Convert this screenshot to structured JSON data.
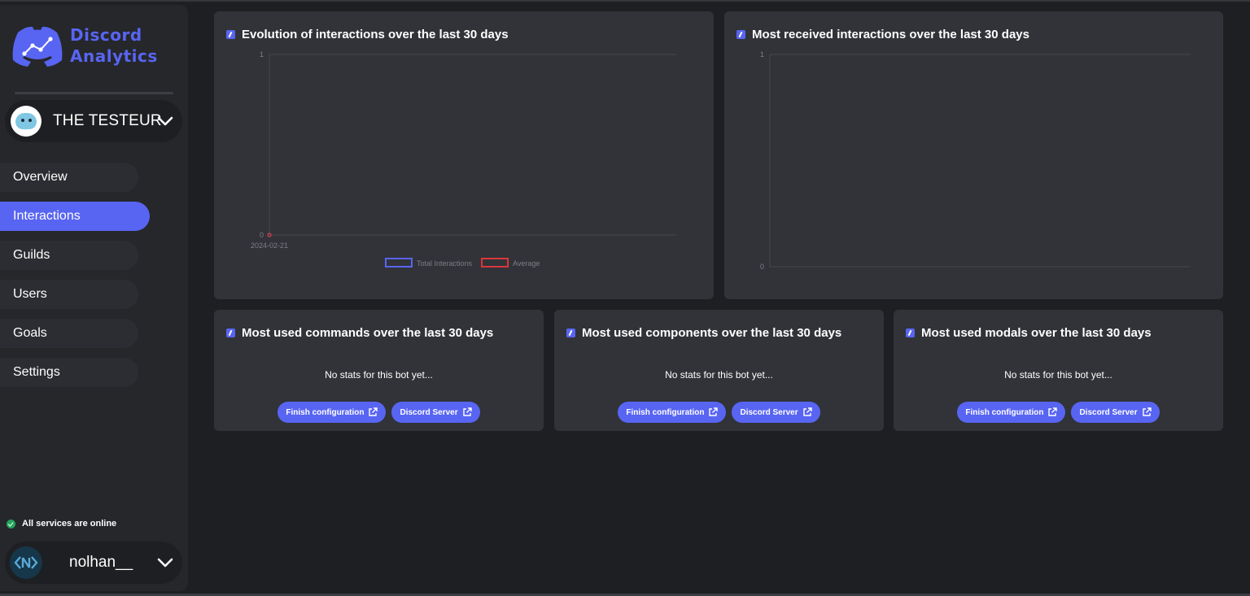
{
  "app": {
    "logo_line1": "Discord",
    "logo_line2": "Analytics"
  },
  "bot_selector": {
    "name": "THE TESTEUR"
  },
  "sidebar": {
    "items": [
      {
        "label": "Overview",
        "active": false
      },
      {
        "label": "Interactions",
        "active": true
      },
      {
        "label": "Guilds",
        "active": false
      },
      {
        "label": "Users",
        "active": false
      },
      {
        "label": "Goals",
        "active": false
      },
      {
        "label": "Settings",
        "active": false
      }
    ]
  },
  "status": {
    "text": "All services are online",
    "color": "#23a55a"
  },
  "user": {
    "name": "nolhan__"
  },
  "colors": {
    "accent": "#5865f2",
    "average": "#da373c"
  },
  "cards": {
    "evolution": {
      "title": "Evolution of interactions over the last 30 days"
    },
    "received": {
      "title": "Most received interactions over the last 30 days"
    },
    "commands": {
      "title": "Most used commands over the last 30 days",
      "empty": "No stats for this bot yet...",
      "btn1": "Finish configuration",
      "btn2": "Discord Server"
    },
    "components": {
      "title": "Most used components over the last 30 days",
      "empty": "No stats for this bot yet...",
      "btn1": "Finish configuration",
      "btn2": "Discord Server"
    },
    "modals": {
      "title": "Most used modals over the last 30 days",
      "empty": "No stats for this bot yet...",
      "btn1": "Finish configuration",
      "btn2": "Discord Server"
    }
  },
  "chart_data": [
    {
      "type": "line",
      "title": "Evolution of interactions over the last 30 days",
      "x": [
        "2024-02-21"
      ],
      "series": [
        {
          "name": "Total Interactions",
          "values": [
            0
          ],
          "color": "#5865f2"
        },
        {
          "name": "Average",
          "values": [
            0
          ],
          "color": "#da373c"
        }
      ],
      "ylim": [
        0,
        1
      ],
      "yticks": [
        "0",
        "1"
      ],
      "legend": "bottom"
    },
    {
      "type": "bar",
      "title": "Most received interactions over the last 30 days",
      "categories": [],
      "values": [],
      "ylim": [
        0,
        1
      ],
      "yticks": [
        "0",
        "1"
      ]
    }
  ]
}
